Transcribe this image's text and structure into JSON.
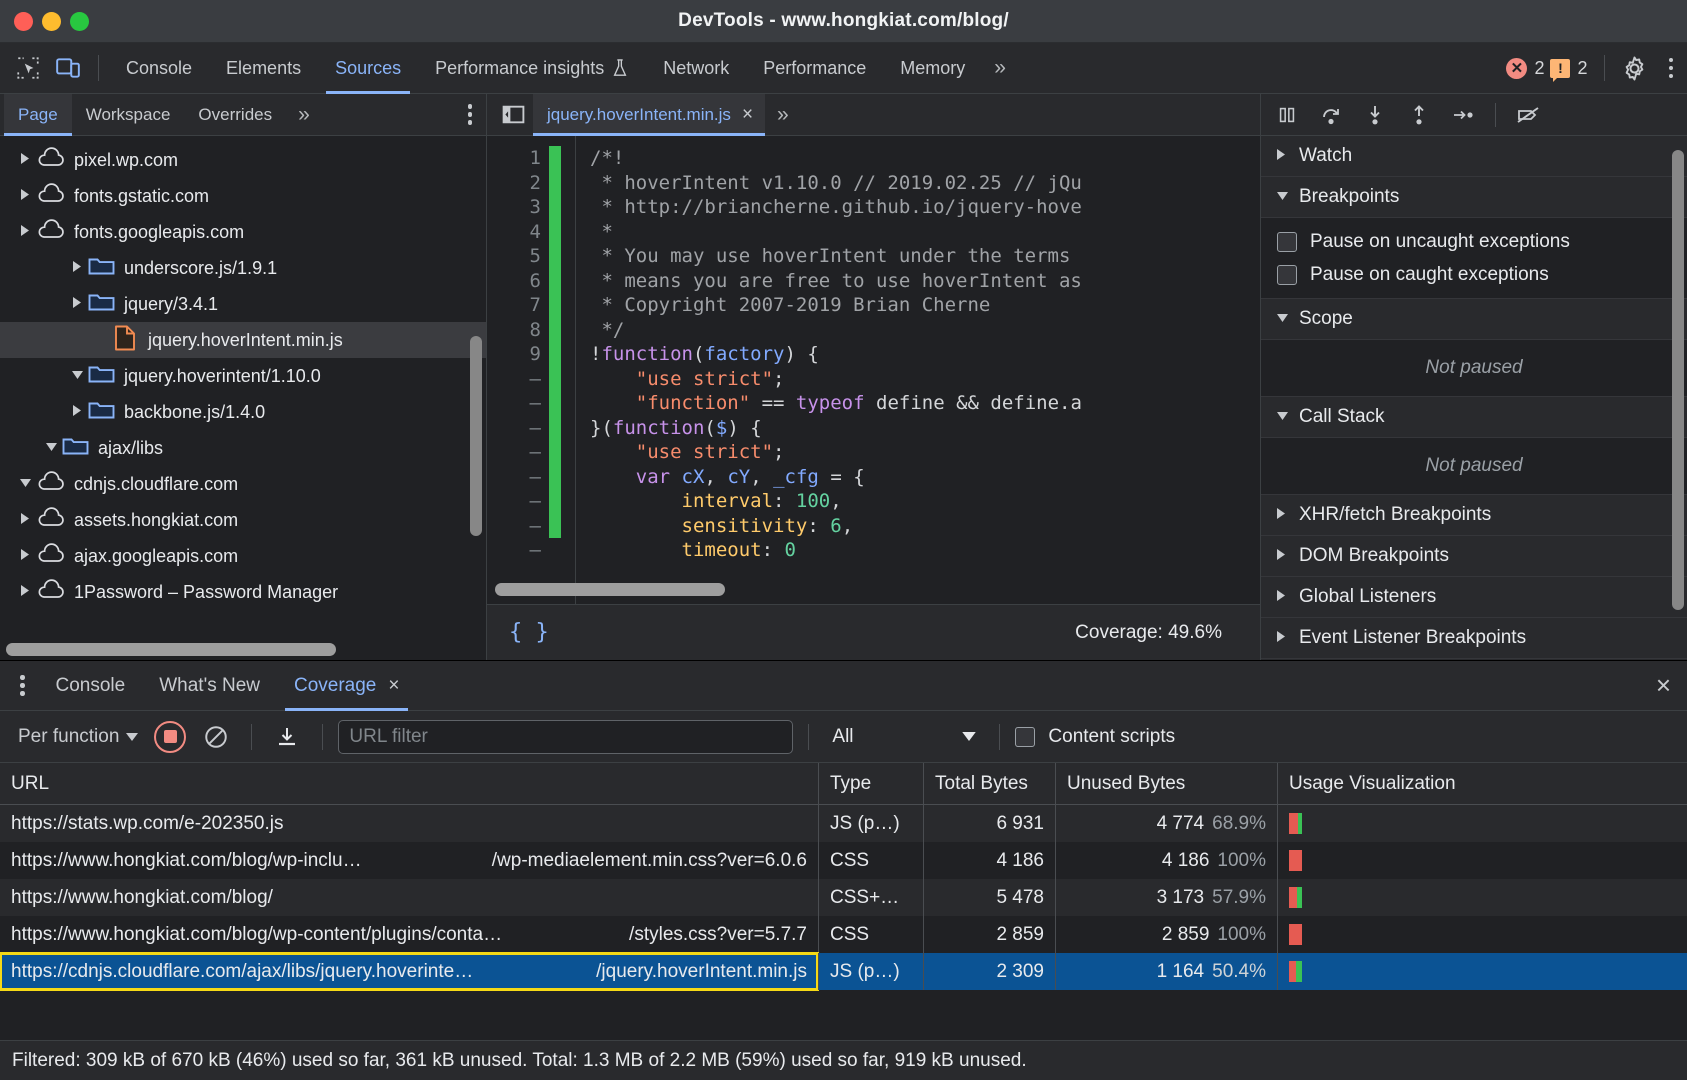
{
  "window": {
    "title": "DevTools - www.hongkiat.com/blog/"
  },
  "main_tabs": {
    "items": [
      {
        "label": "Console",
        "active": false
      },
      {
        "label": "Elements",
        "active": false
      },
      {
        "label": "Sources",
        "active": true
      },
      {
        "label": "Performance insights",
        "active": false,
        "flask": true
      },
      {
        "label": "Network",
        "active": false
      },
      {
        "label": "Performance",
        "active": false
      },
      {
        "label": "Memory",
        "active": false
      }
    ],
    "more": "»",
    "error_count": "2",
    "warning_count": "2"
  },
  "navigator": {
    "tabs": [
      {
        "label": "Page",
        "active": true
      },
      {
        "label": "Workspace",
        "active": false
      },
      {
        "label": "Overrides",
        "active": false
      }
    ],
    "more": "»",
    "tree": [
      {
        "label": "1Password – Password Manager",
        "icon": "cloud-icon",
        "indent": 0,
        "arrow": "right",
        "selected": false
      },
      {
        "label": "ajax.googleapis.com",
        "icon": "cloud-icon",
        "indent": 0,
        "arrow": "right",
        "selected": false
      },
      {
        "label": "assets.hongkiat.com",
        "icon": "cloud-icon",
        "indent": 0,
        "arrow": "right",
        "selected": false
      },
      {
        "label": "cdnjs.cloudflare.com",
        "icon": "cloud-icon",
        "indent": 0,
        "arrow": "down",
        "selected": false
      },
      {
        "label": "ajax/libs",
        "icon": "folder-icon",
        "indent": 1,
        "arrow": "down",
        "selected": false
      },
      {
        "label": "backbone.js/1.4.0",
        "icon": "folder-icon",
        "indent": 2,
        "arrow": "right",
        "selected": false
      },
      {
        "label": "jquery.hoverintent/1.10.0",
        "icon": "folder-icon",
        "indent": 2,
        "arrow": "down",
        "selected": false
      },
      {
        "label": "jquery.hoverIntent.min.js",
        "icon": "js-file-icon",
        "indent": 3,
        "arrow": "none",
        "selected": true
      },
      {
        "label": "jquery/3.4.1",
        "icon": "folder-icon",
        "indent": 2,
        "arrow": "right",
        "selected": false
      },
      {
        "label": "underscore.js/1.9.1",
        "icon": "folder-icon",
        "indent": 2,
        "arrow": "right",
        "selected": false
      },
      {
        "label": "fonts.googleapis.com",
        "icon": "cloud-icon",
        "indent": 0,
        "arrow": "right",
        "selected": false
      },
      {
        "label": "fonts.gstatic.com",
        "icon": "cloud-icon",
        "indent": 0,
        "arrow": "right",
        "selected": false
      },
      {
        "label": "pixel.wp.com",
        "icon": "cloud-icon",
        "indent": 0,
        "arrow": "right",
        "selected": false
      }
    ]
  },
  "editor": {
    "tab_label": "jquery.hoverIntent.min.js",
    "tab_close": "×",
    "more": "»",
    "coverage_label": "Coverage: 49.6%",
    "pretty_print": "{ }",
    "line_numbers": [
      "1",
      "2",
      "3",
      "4",
      "5",
      "6",
      "7",
      "8",
      "9",
      "–",
      "–",
      "–",
      "–",
      "–",
      "–",
      "–",
      "–"
    ],
    "lines": [
      {
        "t": "comment",
        "text": "/*!"
      },
      {
        "t": "comment",
        "text": " * hoverIntent v1.10.0 // 2019.02.25 // jQu"
      },
      {
        "t": "comment",
        "text": " * http://briancherne.github.io/jquery-hove"
      },
      {
        "t": "comment",
        "text": " *"
      },
      {
        "t": "comment",
        "text": " * You may use hoverIntent under the terms "
      },
      {
        "t": "comment",
        "text": " * means you are free to use hoverIntent as"
      },
      {
        "t": "comment",
        "text": " * Copyright 2007-2019 Brian Cherne"
      },
      {
        "t": "comment",
        "text": " */"
      },
      {
        "t": "code",
        "segs": [
          {
            "c": "pl",
            "s": "!"
          },
          {
            "c": "kw",
            "s": "function"
          },
          {
            "c": "pl",
            "s": "("
          },
          {
            "c": "par",
            "s": "factory"
          },
          {
            "c": "pl",
            "s": ") {"
          }
        ]
      },
      {
        "t": "code",
        "segs": [
          {
            "c": "pl",
            "s": "    "
          },
          {
            "c": "str",
            "s": "\"use strict\""
          },
          {
            "c": "pl",
            "s": ";"
          }
        ]
      },
      {
        "t": "code",
        "segs": [
          {
            "c": "pl",
            "s": "    "
          },
          {
            "c": "str",
            "s": "\"function\""
          },
          {
            "c": "pl",
            "s": " == "
          },
          {
            "c": "kw",
            "s": "typeof"
          },
          {
            "c": "pl",
            "s": " define && define.a"
          }
        ]
      },
      {
        "t": "code",
        "segs": [
          {
            "c": "pl",
            "s": "}("
          },
          {
            "c": "kw",
            "s": "function"
          },
          {
            "c": "pl",
            "s": "("
          },
          {
            "c": "par",
            "s": "$"
          },
          {
            "c": "pl",
            "s": ") {"
          }
        ]
      },
      {
        "t": "code",
        "segs": [
          {
            "c": "pl",
            "s": "    "
          },
          {
            "c": "str",
            "s": "\"use strict\""
          },
          {
            "c": "pl",
            "s": ";"
          }
        ]
      },
      {
        "t": "code",
        "segs": [
          {
            "c": "pl",
            "s": "    "
          },
          {
            "c": "kw",
            "s": "var"
          },
          {
            "c": "pl",
            "s": " "
          },
          {
            "c": "par",
            "s": "cX"
          },
          {
            "c": "pl",
            "s": ", "
          },
          {
            "c": "par",
            "s": "cY"
          },
          {
            "c": "pl",
            "s": ", "
          },
          {
            "c": "par",
            "s": "_cfg"
          },
          {
            "c": "pl",
            "s": " = {"
          }
        ]
      },
      {
        "t": "code",
        "segs": [
          {
            "c": "pl",
            "s": "        "
          },
          {
            "c": "prop",
            "s": "interval"
          },
          {
            "c": "pl",
            "s": ": "
          },
          {
            "c": "num",
            "s": "100"
          },
          {
            "c": "pl",
            "s": ","
          }
        ]
      },
      {
        "t": "code",
        "segs": [
          {
            "c": "pl",
            "s": "        "
          },
          {
            "c": "prop",
            "s": "sensitivity"
          },
          {
            "c": "pl",
            "s": ": "
          },
          {
            "c": "num",
            "s": "6"
          },
          {
            "c": "pl",
            "s": ","
          }
        ]
      },
      {
        "t": "code",
        "segs": [
          {
            "c": "pl",
            "s": "        "
          },
          {
            "c": "prop",
            "s": "timeout"
          },
          {
            "c": "pl",
            "s": ": "
          },
          {
            "c": "num",
            "s": "0"
          }
        ]
      }
    ]
  },
  "debugger": {
    "sections": [
      {
        "title": "Watch",
        "expanded": false
      },
      {
        "title": "Breakpoints",
        "expanded": true
      },
      {
        "title": "Scope",
        "expanded": true
      },
      {
        "title": "Call Stack",
        "expanded": true
      },
      {
        "title": "XHR/fetch Breakpoints",
        "expanded": false
      },
      {
        "title": "DOM Breakpoints",
        "expanded": false
      },
      {
        "title": "Global Listeners",
        "expanded": false
      },
      {
        "title": "Event Listener Breakpoints",
        "expanded": false
      }
    ],
    "pause_uncaught": "Pause on uncaught exceptions",
    "pause_caught": "Pause on caught exceptions",
    "scope_status": "Not paused",
    "callstack_status": "Not paused"
  },
  "drawer": {
    "tabs": [
      {
        "label": "Console",
        "active": false,
        "closable": false
      },
      {
        "label": "What's New",
        "active": false,
        "closable": false
      },
      {
        "label": "Coverage",
        "active": true,
        "closable": true
      }
    ],
    "close": "×",
    "toolbar": {
      "mode": "Per function",
      "url_filter_placeholder": "URL filter",
      "url_filter_value": "",
      "type_filter": "All",
      "content_scripts": "Content scripts"
    },
    "table": {
      "columns": [
        "URL",
        "Type",
        "Total Bytes",
        "Unused Bytes",
        "Usage Visualization"
      ],
      "rows": [
        {
          "url": "https://stats.wp.com/e-202350.js",
          "url_suffix": "",
          "type": "JS (p…)",
          "total": "6 931",
          "unused": "4 774",
          "pct": "68.9%",
          "used_ratio": 0.311,
          "selected": false
        },
        {
          "url": "https://www.hongkiat.com/blog/wp-inclu…",
          "url_suffix": "/wp-mediaelement.min.css?ver=6.0.6",
          "type": "CSS",
          "total": "4 186",
          "unused": "4 186",
          "pct": "100%",
          "used_ratio": 0,
          "selected": false
        },
        {
          "url": "https://www.hongkiat.com/blog/",
          "url_suffix": "",
          "type": "CSS+…",
          "total": "5 478",
          "unused": "3 173",
          "pct": "57.9%",
          "used_ratio": 0.421,
          "selected": false
        },
        {
          "url": "https://www.hongkiat.com/blog/wp-content/plugins/conta…",
          "url_suffix": "/styles.css?ver=5.7.7",
          "type": "CSS",
          "total": "2 859",
          "unused": "2 859",
          "pct": "100%",
          "used_ratio": 0,
          "selected": false
        },
        {
          "url": "https://cdnjs.cloudflare.com/ajax/libs/jquery.hoverinte…",
          "url_suffix": "/jquery.hoverIntent.min.js",
          "type": "JS (p…)",
          "total": "2 309",
          "unused": "1 164",
          "pct": "50.4%",
          "used_ratio": 0.496,
          "selected": true
        }
      ]
    },
    "status": "Filtered: 309 kB of 670 kB (46%) used so far, 361 kB unused. Total: 1.3 MB of 2.2 MB (59%) used so far, 919 kB unused."
  },
  "colors": {
    "accent": "#8ab4f8",
    "selected_row": "#0b5394",
    "highlight_border": "#f5d916",
    "coverage_green": "#3ac255",
    "coverage_red": "#e55b52",
    "error": "#f28b82",
    "warning": "#fdb675"
  }
}
